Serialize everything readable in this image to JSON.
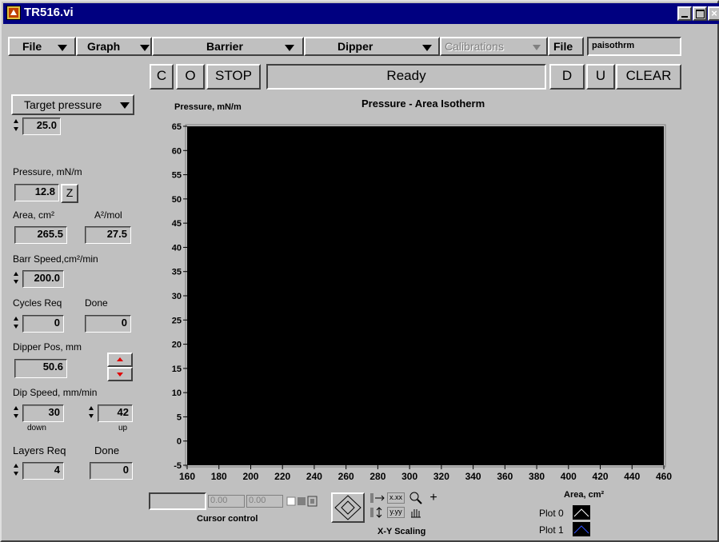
{
  "window": {
    "title": "TR516.vi"
  },
  "menubar": {
    "file": "File",
    "graph": "Graph",
    "barrier": "Barrier",
    "dipper": "Dipper",
    "calibrations": "Calibrations",
    "file2": "File",
    "filename": "paisothrm"
  },
  "buttons": {
    "c": "C",
    "o": "O",
    "stop": "STOP",
    "d": "D",
    "u": "U",
    "clear": "CLEAR"
  },
  "status": "Ready",
  "controls": {
    "target_label": "Target pressure",
    "target_value": "25.0",
    "pressure_label": "Pressure, mN/m",
    "pressure_value": "12.8",
    "zero_btn": "Z",
    "area_label": "Area, cm²",
    "area_value": "265.5",
    "apm_label": "A²/mol",
    "apm_value": "27.5",
    "barr_speed_label": "Barr Speed,cm²/min",
    "barr_speed_value": "200.0",
    "cycles_label": "Cycles Req",
    "done_label": "Done",
    "cycles_req_value": "0",
    "cycles_done_value": "0",
    "dipper_pos_label": "Dipper Pos, mm",
    "dipper_pos_value": "50.6",
    "dip_speed_label": "Dip Speed, mm/min",
    "dip_down_value": "30",
    "dip_up_value": "42",
    "down_label": "down",
    "up_label": "up",
    "layers_label": "Layers Req",
    "layers_done_label": "Done",
    "layers_req_value": "4",
    "layers_done_value": "0"
  },
  "chart_data": {
    "type": "scatter",
    "title": "Pressure - Area Isotherm",
    "ylabel": "Pressure, mN/m",
    "xlabel": "Area, cm²",
    "xlim": [
      160,
      460
    ],
    "ylim": [
      -5,
      65
    ],
    "xticks": [
      160,
      180,
      200,
      220,
      240,
      260,
      280,
      300,
      320,
      340,
      360,
      380,
      400,
      420,
      440,
      460
    ],
    "yticks": [
      65,
      60,
      55,
      50,
      45,
      40,
      35,
      30,
      25,
      20,
      15,
      10,
      5,
      0,
      -5
    ],
    "series": [],
    "legend": [
      "Plot 0",
      "Plot 1"
    ],
    "plot_background": "#000000"
  },
  "cursor": {
    "label": "Cursor control",
    "x": "0.00",
    "y": "0.00"
  },
  "scaling": {
    "label": "X-Y Scaling",
    "x_fmt": "x.xx",
    "y_fmt": "y.yy"
  }
}
